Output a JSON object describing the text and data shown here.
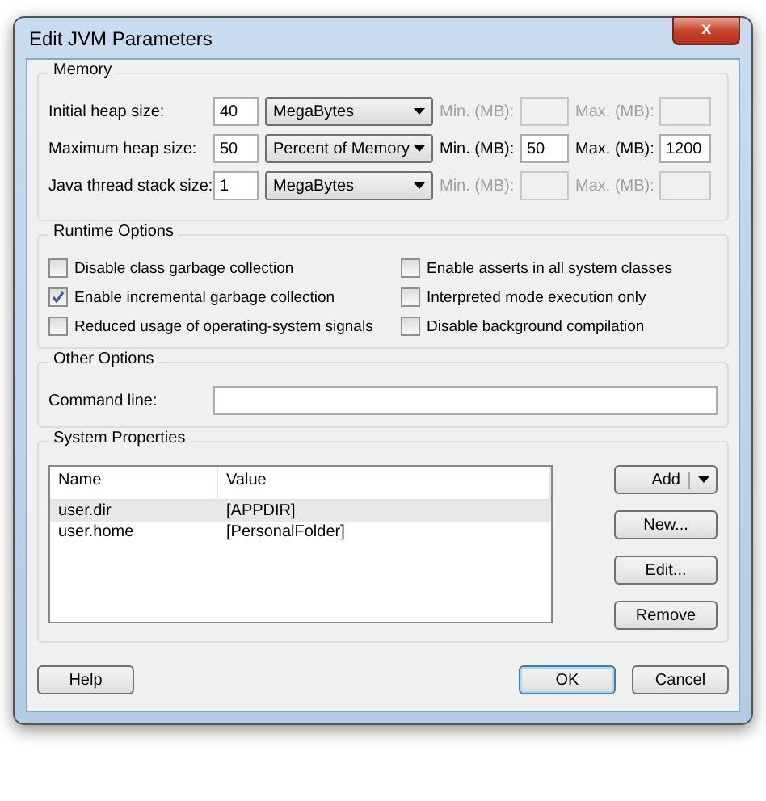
{
  "window": {
    "title": "Edit JVM Parameters",
    "close": "x"
  },
  "memory": {
    "title": "Memory",
    "rows": [
      {
        "label": "Initial heap size:",
        "value": "40",
        "unit": "MegaBytes",
        "min_label": "Min. (MB):",
        "min": "",
        "max_label": "Max. (MB):",
        "max": "",
        "range_enabled": false
      },
      {
        "label": "Maximum heap size:",
        "value": "50",
        "unit": "Percent of Memory",
        "min_label": "Min. (MB):",
        "min": "50",
        "max_label": "Max. (MB):",
        "max": "1200",
        "range_enabled": true
      },
      {
        "label": "Java thread stack size:",
        "value": "1",
        "unit": "MegaBytes",
        "min_label": "Min. (MB):",
        "min": "",
        "max_label": "Max. (MB):",
        "max": "",
        "range_enabled": false
      }
    ]
  },
  "runtime_options": {
    "title": "Runtime Options",
    "options": [
      {
        "label": "Disable class garbage collection",
        "checked": false
      },
      {
        "label": "Enable asserts in all system classes",
        "checked": false
      },
      {
        "label": "Enable incremental garbage collection",
        "checked": true
      },
      {
        "label": "Interpreted mode execution only",
        "checked": false
      },
      {
        "label": "Reduced usage of operating-system signals",
        "checked": false
      },
      {
        "label": "Disable background compilation",
        "checked": false
      }
    ]
  },
  "other_options": {
    "title": "Other Options",
    "command_line_label": "Command line:"
  },
  "system_properties": {
    "title": "System Properties",
    "columns": [
      "Name",
      "Value"
    ],
    "rows": [
      {
        "name": "user.dir",
        "value": "[APPDIR]",
        "selected": true
      },
      {
        "name": "user.home",
        "value": "[PersonalFolder]",
        "selected": false
      }
    ],
    "buttons": [
      "Add",
      "New...",
      "Edit...",
      "Remove"
    ]
  },
  "footer": {
    "buttons": [
      {
        "label": "Help",
        "default": false
      },
      {
        "label": "OK",
        "default": true
      },
      {
        "label": "Cancel",
        "default": false
      }
    ]
  }
}
